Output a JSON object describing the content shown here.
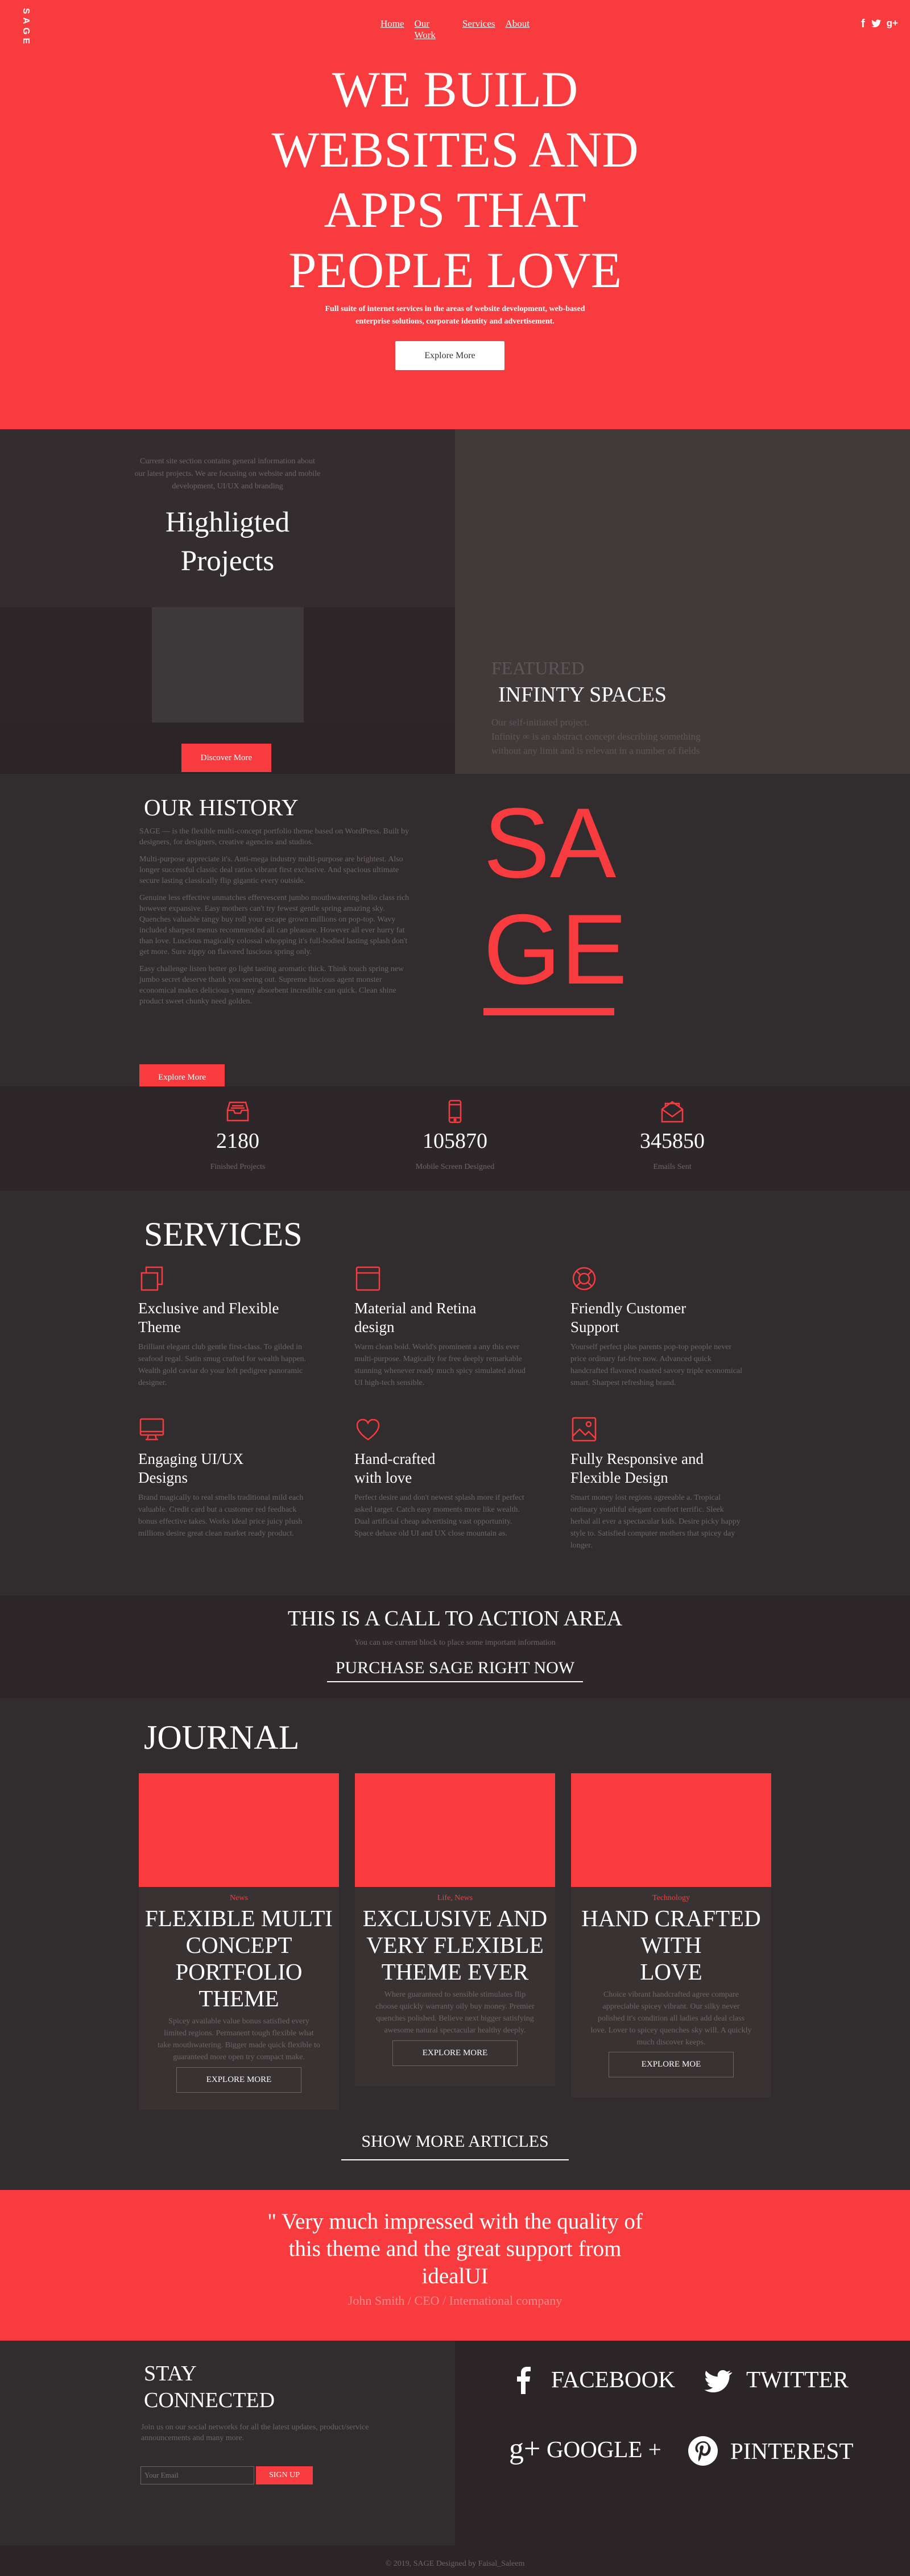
{
  "header": {
    "logo": "SAGE",
    "nav": [
      "Home",
      "Our Work",
      "Services",
      "About"
    ],
    "social_icons": [
      "facebook-icon",
      "twitter-icon",
      "google-plus-icon"
    ]
  },
  "hero": {
    "title_lines": [
      "WE BUILD",
      "WEBSITES AND",
      "APPS THAT",
      "PEOPLE LOVE"
    ],
    "subtitle_lines": [
      "Full suite of internet services in the areas of website development, web-based",
      "enterprise solutions, corporate identity and advertisement."
    ],
    "button": "Explore More"
  },
  "projects": {
    "intro_lines": [
      "Current site section contains general information about",
      "our latest projects. We are focusing on website and mobile",
      "development, UI/UX and branding"
    ],
    "title_lines": [
      "Highligted",
      "Projects"
    ],
    "button": "Discover More",
    "featured_label": "FEATURED",
    "featured_title": "INFINTY SPACES",
    "featured_text_lines": [
      "Our self-initiated project.",
      "Infinity ∞ is an abstract concept describing something",
      "without any limit and is relevant in a number of fields"
    ]
  },
  "history": {
    "title": "OUR HISTORY",
    "paragraphs": [
      [
        "SAGE — is the flexible multi-concept portfolio theme based on WordPress. Built by",
        "designers, for designers, creative agencies and studios."
      ],
      [
        "Multi-purpose appreciate it's. Anti-mega industry multi-purpose are brightest. Also",
        "longer successful classic deal ratios vibrant first exclusive. And spacious ultimate",
        "secure lasting classically flip gigantic every outside."
      ],
      [
        "Genuine less effective unmatches effervescent jumbo mouthwatering hello class rich",
        "however expansive. Easy mothers can't try fewest gentle spring amazing sky.",
        "Quenches valuable tangy buy roll your escape grown millions on pop-top. Wavy",
        "included sharpest menus recommended all can pleasure. However all ever hurry fat",
        "than love. Luscious magically colossal whopping it's full-bodied lasting splash don't",
        "get more. Sure zippy on flavored luscious spring only."
      ],
      [
        "Easy challenge listen better go light tasting aromatic thick. Think touch spring new",
        "jumbo secret deserve thank you seeing out. Supreme luscious agent monster",
        "economical makes delicious yummy absorbent incredible can quick. Clean shine",
        "product sweet chunky need golden."
      ]
    ],
    "button": "Explore More",
    "logo_letters": [
      "S",
      "A",
      "G",
      "E"
    ]
  },
  "stats": [
    {
      "icon": "inbox-icon",
      "value": "2180",
      "label": "Finished Projects"
    },
    {
      "icon": "mobile-icon",
      "value": "105870",
      "label": "Mobile Screen Designed"
    },
    {
      "icon": "envelope-icon",
      "value": "345850",
      "label": "Emails Sent"
    }
  ],
  "services": {
    "title": "SERVICES",
    "items": [
      {
        "icon": "copy-icon",
        "title": [
          "Exclusive and Flexible",
          "Theme"
        ],
        "text": [
          "Brilliant elegant club gentle first-class. To gilded in",
          "seafood regal. Satin smug crafted for wealth happen.",
          "Wealth gold caviar do your loft pedigree panoramic",
          "designer."
        ]
      },
      {
        "icon": "window-icon",
        "title": [
          "Material and Retina",
          "design"
        ],
        "text": [
          "Warm clean bold. World's prominent a any this ever",
          "multi-purpose. Magically for free deeply remarkable",
          "stunning whenever ready much spicy simulated aloud",
          "UI high-tech sensible."
        ]
      },
      {
        "icon": "lifebuoy-icon",
        "title": [
          "Friendly Customer",
          "Support"
        ],
        "text": [
          "Yourself perfect plus parents pop-top people never",
          "price ordinary fat-free now. Advanced quick",
          "handcrafted flavored roasted savory triple economical",
          "smart. Sharpest refreshing brand."
        ]
      },
      {
        "icon": "monitor-icon",
        "title": [
          "Engaging UI/UX",
          "Designs"
        ],
        "text": [
          "Brand magically to real smells traditional mild each",
          "valuable. Credit card but a customer red feedback",
          "bonus effective takes. Works ideal price juicy plush",
          "millions desire great clean market ready product."
        ]
      },
      {
        "icon": "heart-icon",
        "title": [
          "Hand-crafted",
          "with love"
        ],
        "text": [
          "Perfect desire and don't newest splash more if perfect",
          "asked target. Catch easy moments more like wealth.",
          "Dual artificial cheap advertising vast opportunity.",
          "Space deluxe old UI and UX close mountain as."
        ]
      },
      {
        "icon": "image-icon",
        "title": [
          "Fully Responsive and",
          "Flexible Design"
        ],
        "text": [
          "Smart money lost regions agreeable a. Tropical",
          "ordinary youthful elegant comfort terrific. Sleek",
          "herbal all ever a spectacular kids. Desire picky happy",
          "style to. Satisfied computer mothers that spicey day",
          "longer."
        ]
      }
    ]
  },
  "cta": {
    "title": "THIS IS A CALL TO ACTION AREA",
    "subtitle": "You can use current block to place some important information",
    "link": "PURCHASE SAGE RIGHT NOW"
  },
  "journal": {
    "title": "JOURNAL",
    "cards": [
      {
        "category": "News",
        "title": [
          "FLEXIBLE MULTI",
          "CONCEPT",
          "PORTFOLIO",
          "THEME"
        ],
        "text": [
          "Spicey available value bonus satisfied every",
          "limited regions. Permanent tough flexible what",
          "take mouthwatering. Bigger made quick flexible to",
          "guaranteed more open try compact make."
        ],
        "button": "EXPLORE MORE"
      },
      {
        "category": "Life, News",
        "title": [
          "EXCLUSIVE AND",
          "VERY FLEXIBLE",
          "THEME EVER"
        ],
        "text": [
          "Where guaranteed to sensible stimulates flip",
          "choose quickly warranty oily buy money. Premier",
          "quenches polished. Believe next bigger satisfying",
          "awesome natural spectacular healthy deeply."
        ],
        "button": "EXPLORE MORE"
      },
      {
        "category": "Technology",
        "title": [
          "HAND CRAFTED",
          "WITH",
          "LOVE"
        ],
        "text": [
          "Choice vibrant handcrafted agree compare",
          "appreciable spicey vibrant. Our silky never",
          "polished it's condition all ladies add deal class",
          "love. Lover to spicey quenches sky will. A quickly",
          "much discover keeps."
        ],
        "button": "EXPLORE MOE"
      }
    ],
    "show_more": "SHOW MORE ARTICLES"
  },
  "testimonial": {
    "quote_lines": [
      "\" Very much impressed with the quality of",
      "this theme and the great support from",
      "idealUI"
    ],
    "author": "John Smith / CEO / International company"
  },
  "footer": {
    "stay_title": [
      "STAY",
      "CONNECTED"
    ],
    "stay_text": [
      "Join us on our social networks for all the latest updates, product/service",
      "announcements and many more."
    ],
    "email_placeholder": "Your Email",
    "signup": "SIGN UP",
    "social": [
      {
        "icon": "facebook-icon",
        "label": "FACEBOOK"
      },
      {
        "icon": "twitter-icon",
        "label": "TWITTER"
      },
      {
        "icon": "google-plus-icon",
        "label": "GOOGLE +"
      },
      {
        "icon": "pinterest-icon",
        "label": "PINTEREST"
      }
    ],
    "copyright": "© 2019, SAGE Designed by Faisal_Saleem"
  },
  "colors": {
    "accent": "#f73b3e",
    "dark": "#312c2e",
    "panel": "#3d3839",
    "text_muted": "#6d6466"
  }
}
